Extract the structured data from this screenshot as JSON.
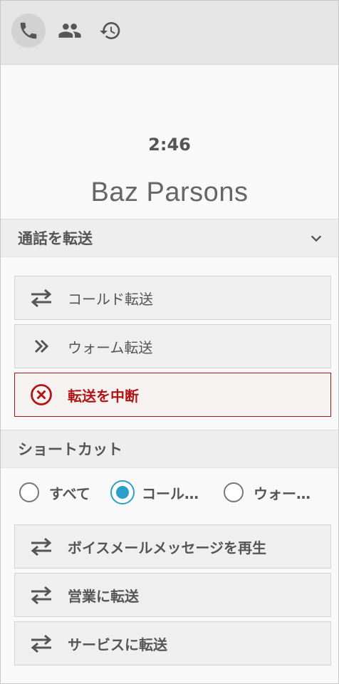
{
  "topbar": {
    "icons": [
      "phone-icon",
      "people-icon",
      "history-icon"
    ]
  },
  "call": {
    "timer": "2:46",
    "caller_name": "Baz Parsons"
  },
  "transfer": {
    "header": "通話を転送",
    "actions": [
      {
        "label": "コールド転送",
        "icon": "transfer-arrows-icon"
      },
      {
        "label": "ウォーム転送",
        "icon": "double-chevron-right-icon"
      },
      {
        "label": "転送を中断",
        "icon": "cancel-circle-icon"
      }
    ]
  },
  "shortcuts": {
    "header": "ショートカット",
    "filters": [
      {
        "label": "すべて",
        "selected": false
      },
      {
        "label": "コール…",
        "selected": true
      },
      {
        "label": "ウォー…",
        "selected": false
      }
    ],
    "actions": [
      {
        "label": "ボイスメールメッセージを再生",
        "icon": "transfer-arrows-icon"
      },
      {
        "label": "営業に転送",
        "icon": "transfer-arrows-icon"
      },
      {
        "label": "サービスに転送",
        "icon": "transfer-arrows-icon"
      }
    ]
  },
  "colors": {
    "accent": "#2aa0c9",
    "danger": "#b01616",
    "topbar_bg": "#e5e5e5"
  }
}
